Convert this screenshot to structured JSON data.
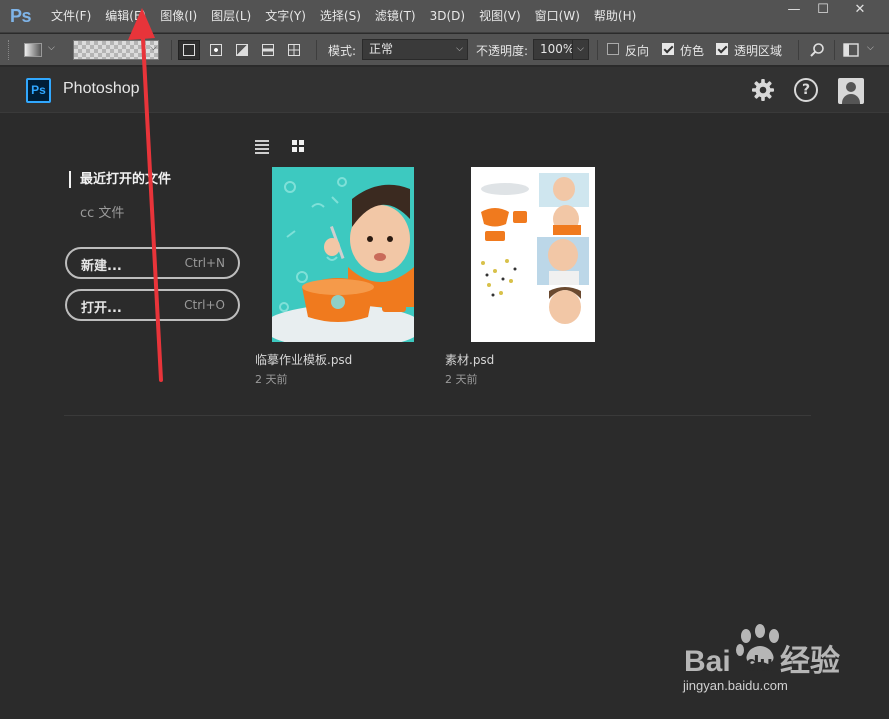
{
  "app": {
    "logo_small": "Ps",
    "badge": "Ps",
    "name": "Photoshop"
  },
  "menu": {
    "items": [
      "文件(F)",
      "编辑(E)",
      "图像(I)",
      "图层(L)",
      "文字(Y)",
      "选择(S)",
      "滤镜(T)",
      "3D(D)",
      "视图(V)",
      "窗口(W)",
      "帮助(H)"
    ]
  },
  "window_controls": {
    "minimize": "—",
    "maximize": "☐",
    "close": "✕"
  },
  "options_bar": {
    "mode_label": "模式:",
    "mode_value": "正常",
    "opacity_label": "不透明度:",
    "opacity_value": "100%",
    "reverse_label": "反向",
    "reverse_checked": false,
    "dither_label": "仿色",
    "dither_checked": true,
    "transparency_label": "透明区域",
    "transparency_checked": true
  },
  "sidebar": {
    "active_item": "最近打开的文件",
    "cc_files": "cc 文件",
    "new_button": {
      "label": "新建...",
      "shortcut": "Ctrl+N"
    },
    "open_button": {
      "label": "打开...",
      "shortcut": "Ctrl+O"
    }
  },
  "recent_files": [
    {
      "name": "临摹作业模板.psd",
      "date": "2 天前"
    },
    {
      "name": "素材.psd",
      "date": "2 天前"
    }
  ],
  "icons": {
    "settings": "gear-icon",
    "help": "?",
    "user": "user-icon"
  },
  "watermark": {
    "brand": "Bai du 经验",
    "url": "jingyan.baidu.com"
  },
  "colors": {
    "accent": "#31a8ff",
    "annotation": "#e8343a",
    "teal_bg": "#3dc9c0",
    "bowl_orange": "#f07a1e"
  }
}
